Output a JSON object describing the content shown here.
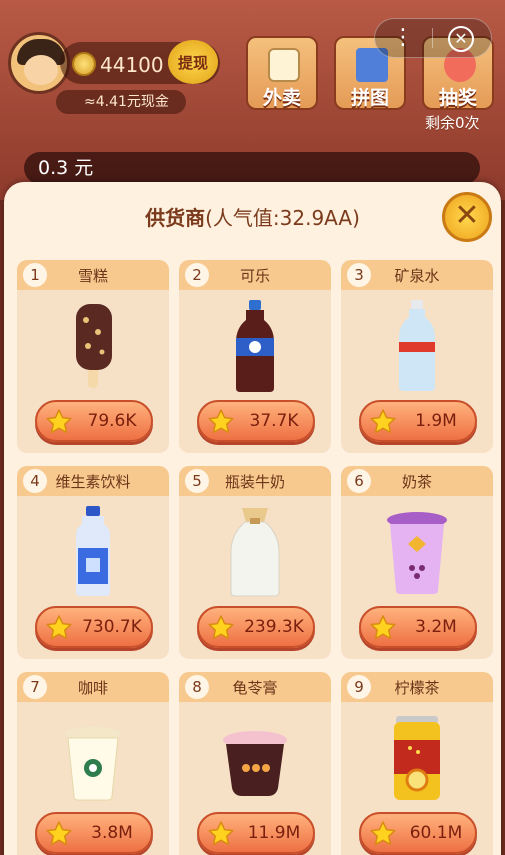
{
  "header": {
    "coins": "44100",
    "withdraw_label": "提现",
    "cash": "≈4.41元现金",
    "tiles": [
      {
        "label": "外卖",
        "icon": "delivery-bag-icon"
      },
      {
        "label": "拼图",
        "icon": "puzzle-icon"
      },
      {
        "label": "抽奖",
        "icon": "lottery-icon"
      }
    ],
    "remaining": "剩余0次",
    "balance": "0.3 元"
  },
  "panel": {
    "title": "供货商",
    "popularity": "(人气值:32.9AA)"
  },
  "items": [
    {
      "num": "1",
      "name": "雪糕",
      "price": "79.6K",
      "icon": "ice-cream-bar-icon"
    },
    {
      "num": "2",
      "name": "可乐",
      "price": "37.7K",
      "icon": "cola-bottle-icon"
    },
    {
      "num": "3",
      "name": "矿泉水",
      "price": "1.9M",
      "icon": "water-bottle-icon"
    },
    {
      "num": "4",
      "name": "维生素饮料",
      "price": "730.7K",
      "icon": "vitamin-drink-icon"
    },
    {
      "num": "5",
      "name": "瓶装牛奶",
      "price": "239.3K",
      "icon": "milk-bottle-icon"
    },
    {
      "num": "6",
      "name": "奶茶",
      "price": "3.2M",
      "icon": "milk-tea-cup-icon"
    },
    {
      "num": "7",
      "name": "咖啡",
      "price": "3.8M",
      "icon": "coffee-cup-icon"
    },
    {
      "num": "8",
      "name": "龟苓膏",
      "price": "11.9M",
      "icon": "herbal-jelly-icon"
    },
    {
      "num": "9",
      "name": "柠檬茶",
      "price": "60.1M",
      "icon": "lemon-tea-can-icon"
    }
  ],
  "colors": {
    "panel_bg": "#fff1e0",
    "card_bg": "#f6e0c6",
    "card_header": "#f8c98f",
    "price_button": "#ee7043",
    "star": "#ffd21f"
  }
}
